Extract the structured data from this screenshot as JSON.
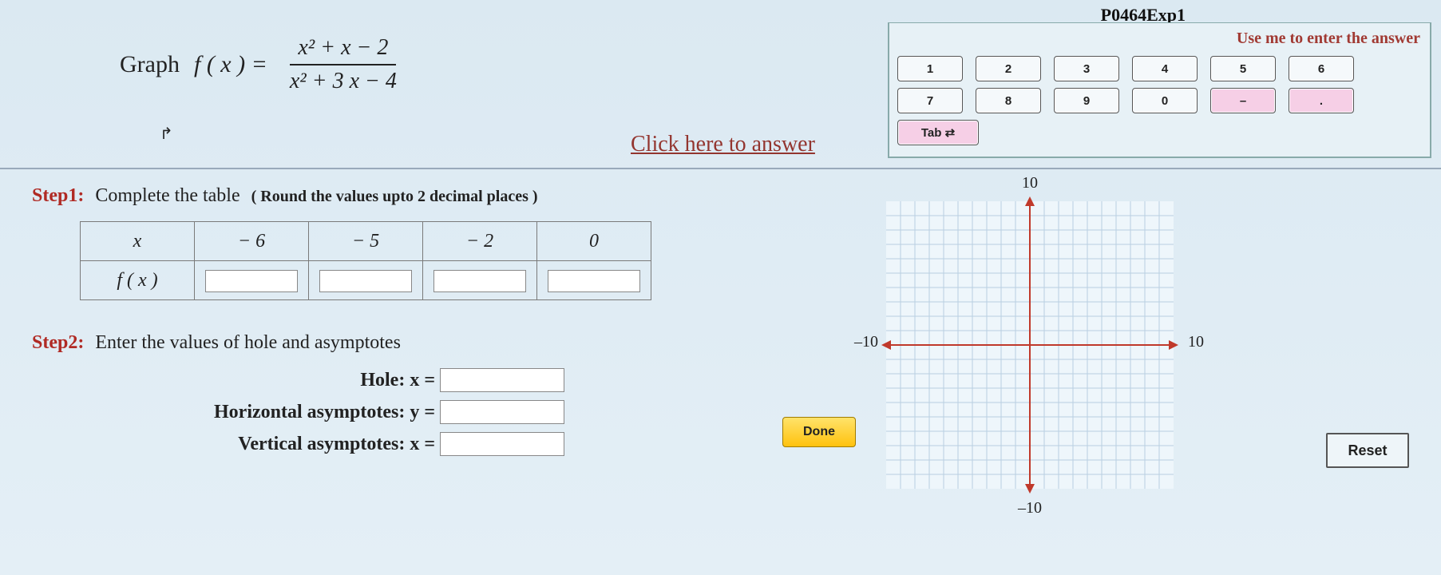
{
  "header": {
    "id": "P0464Exp1"
  },
  "formula": {
    "prefix": "Graph",
    "lhs": "f ( x )  =",
    "numerator": "x²  +  x  −  2",
    "denominator": "x²  +  3 x  −  4"
  },
  "answer_link": "Click here to answer",
  "keypad": {
    "title": "Use me to enter the answer",
    "row1": [
      "1",
      "2",
      "3",
      "4",
      "5",
      "6"
    ],
    "row2": [
      "7",
      "8",
      "9",
      "0",
      "–",
      "."
    ],
    "tab": "Tab  ⇄"
  },
  "step1": {
    "label": "Step1:",
    "text": "Complete the table",
    "note": "( Round the values upto 2 decimal places )",
    "xheader": "x",
    "fheader": "f ( x )",
    "xvalues": [
      "− 6",
      "− 5",
      "− 2",
      "0"
    ]
  },
  "step2": {
    "label": "Step2:",
    "text": "Enter the values of hole and asymptotes",
    "hole": "Hole:  x =",
    "hasym": "Horizontal asymptotes:  y =",
    "vasym": "Vertical asymptotes:  x ="
  },
  "buttons": {
    "done": "Done",
    "reset": "Reset"
  },
  "graph": {
    "top": "10",
    "bottom": "–10",
    "left": "–10",
    "right": "10"
  }
}
